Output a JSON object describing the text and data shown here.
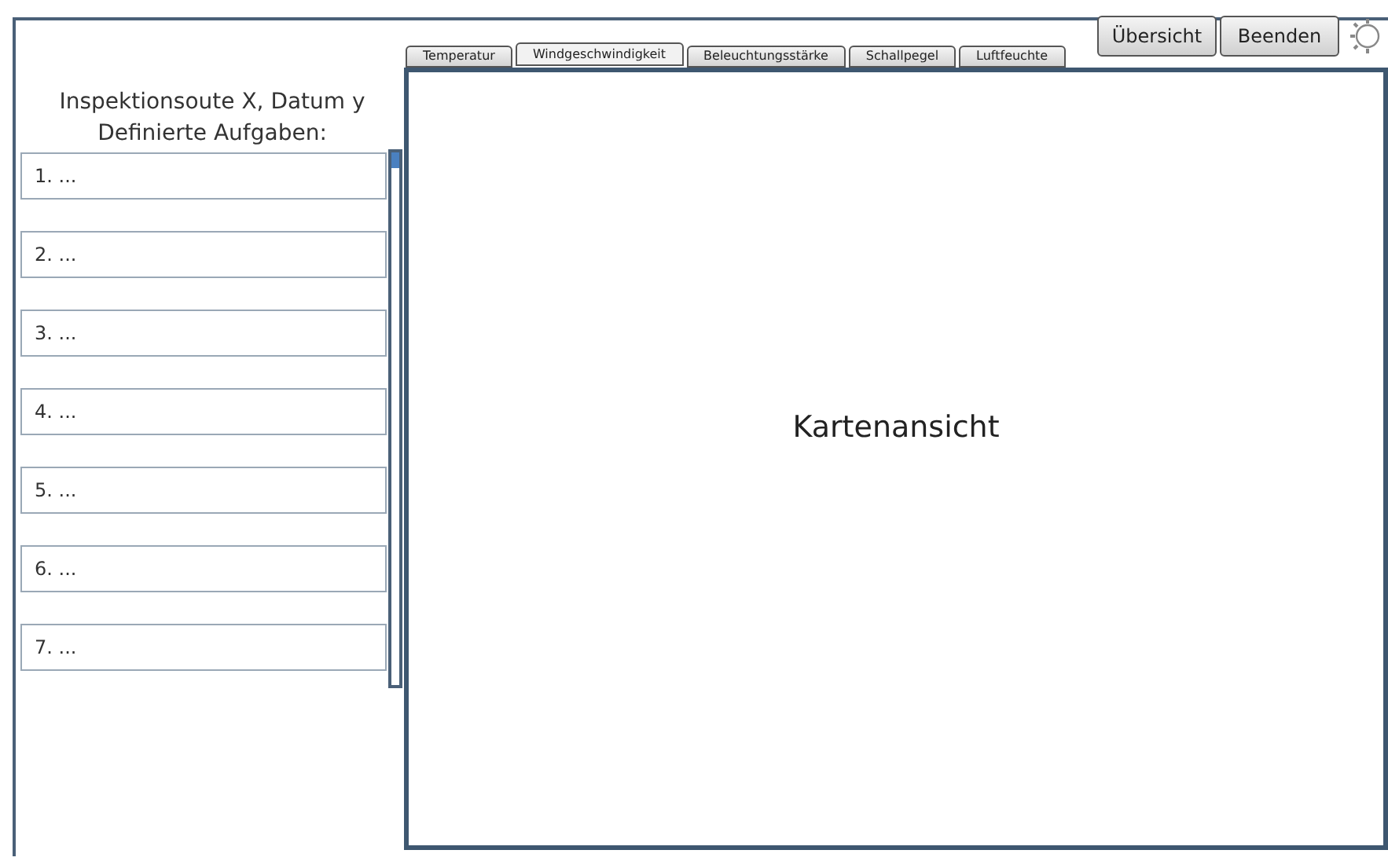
{
  "sidebar": {
    "title": "Inspektionsoute X, Datum y",
    "subtitle": "Definierte Aufgaben:",
    "tasks": [
      {
        "label": "1. ..."
      },
      {
        "label": "2. ..."
      },
      {
        "label": "3. ..."
      },
      {
        "label": "4. ..."
      },
      {
        "label": "5. ..."
      },
      {
        "label": "6. ..."
      },
      {
        "label": "7. ..."
      }
    ]
  },
  "tabs": [
    {
      "label": "Temperatur",
      "selected": false
    },
    {
      "label": "Windgeschwindigkeit",
      "selected": true
    },
    {
      "label": "Beleuchtungsstärke",
      "selected": false
    },
    {
      "label": "Schallpegel",
      "selected": false
    },
    {
      "label": "Luftfeuchte",
      "selected": false
    }
  ],
  "buttons": [
    {
      "label": "Übersicht"
    },
    {
      "label": "Beenden"
    }
  ],
  "map": {
    "label": "Kartenansicht"
  }
}
